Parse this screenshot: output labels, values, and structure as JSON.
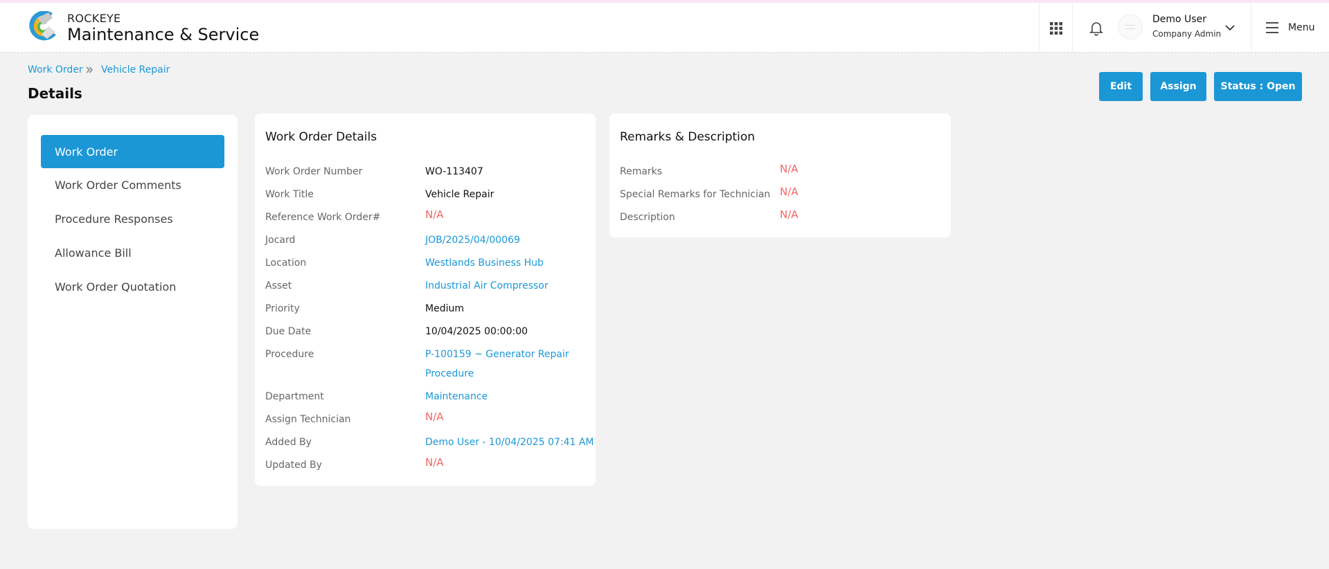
{
  "header": {
    "brand_top": "ROCKEYE",
    "brand_main": "Maintenance & Service",
    "user_name": "Demo User",
    "user_role": "Company Admin",
    "menu_label": "Menu"
  },
  "breadcrumb": [
    "Work Order",
    "Vehicle Repair"
  ],
  "page_title": "Details",
  "actions": {
    "edit": "Edit",
    "assign": "Assign",
    "status": "Status : Open"
  },
  "sidebar": {
    "items": [
      {
        "label": "Work Order",
        "active": true
      },
      {
        "label": "Work Order Comments"
      },
      {
        "label": "Procedure Responses"
      },
      {
        "label": "Allowance Bill"
      },
      {
        "label": "Work Order Quotation"
      }
    ]
  },
  "details": {
    "title": "Work Order Details",
    "rows": [
      {
        "label": "Work Order Number",
        "value": "WO-113407"
      },
      {
        "label": "Work Title",
        "value": "Vehicle Repair"
      },
      {
        "label": "Reference Work Order#",
        "value": "N/A"
      },
      {
        "label": "Jocard",
        "value": "JOB/2025/04/00069"
      },
      {
        "label": "Location",
        "value": "Westlands Business Hub"
      },
      {
        "label": "Asset",
        "value": "Industrial Air Compressor"
      },
      {
        "label": "Priority",
        "value": "Medium"
      },
      {
        "label": "Due Date",
        "value": "10/04/2025 00:00:00"
      },
      {
        "label": "Procedure",
        "value_line1": "P-100159 ~ Generator Repair",
        "value_line2": "Procedure"
      },
      {
        "label": "Department",
        "value": "Maintenance"
      },
      {
        "label": "Assign Technician",
        "value": "N/A"
      },
      {
        "label": "Added By",
        "value": "Demo User - 10/04/2025 07:41 AM"
      },
      {
        "label": "Updated By",
        "value": "N/A"
      }
    ]
  },
  "remarks": {
    "title": "Remarks & Description",
    "rows": [
      {
        "label": "Remarks",
        "value": "N/A"
      },
      {
        "label": "Special Remarks for Technician",
        "value": "N/A"
      },
      {
        "label": "Description",
        "value": "N/A"
      }
    ]
  },
  "colors": {
    "accent": "#1b97d5",
    "na": "#f06565",
    "background": "#f2f2f2"
  },
  "icons": [
    "logo-icon",
    "apps-grid-icon",
    "bell-icon",
    "chevron-down-icon",
    "hamburger-icon",
    "chevron-double-right-icon"
  ]
}
